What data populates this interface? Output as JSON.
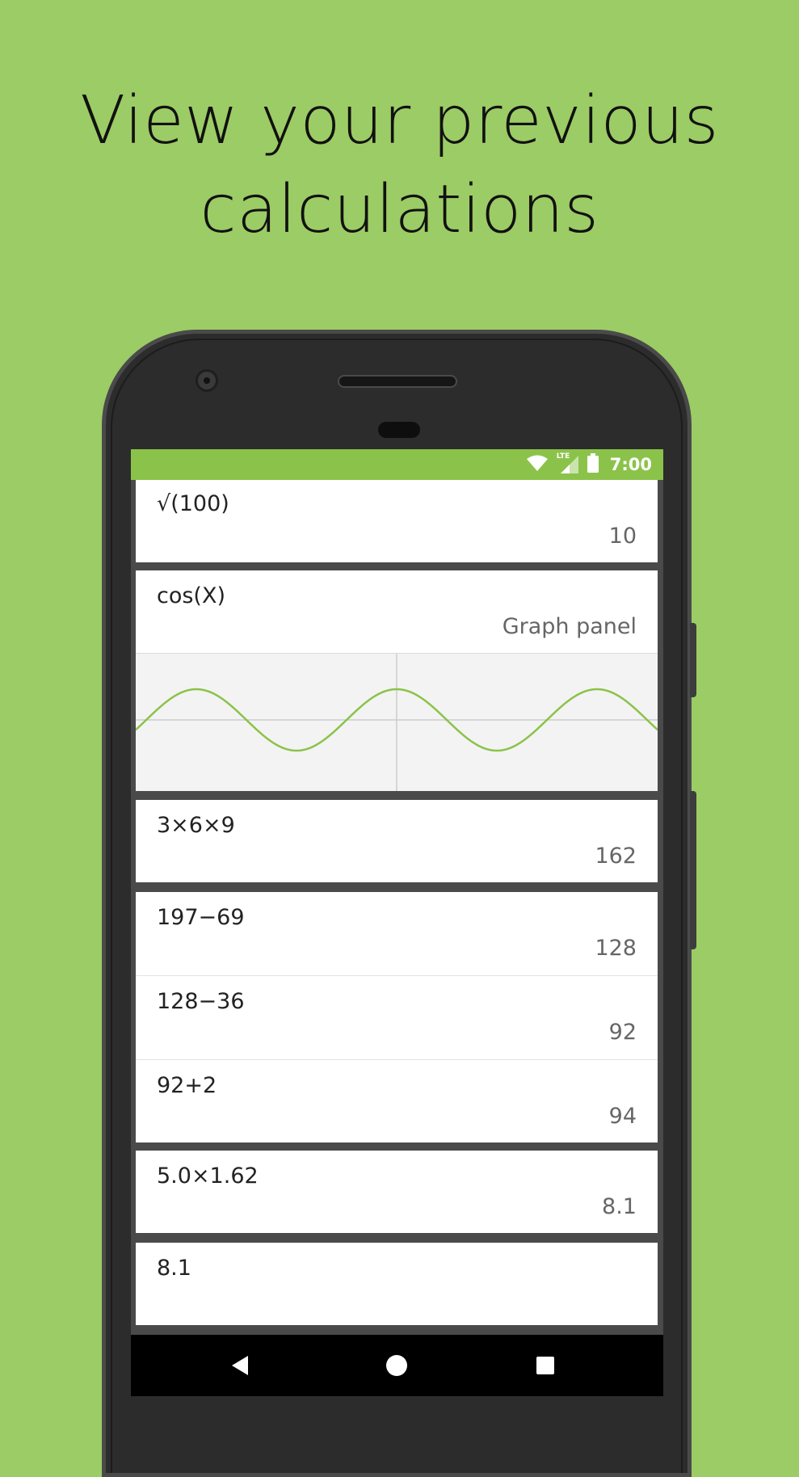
{
  "headline": {
    "line1": "View your previous",
    "line2": "calculations"
  },
  "status_bar": {
    "time": "7:00",
    "icons": [
      "wifi-icon",
      "lte-signal-icon",
      "battery-icon"
    ],
    "lte_label": "LTE"
  },
  "history": {
    "card1": {
      "expression": "√(100)",
      "result": "10"
    },
    "card2": {
      "expression": "cos(X)",
      "result": "Graph panel"
    },
    "card3": {
      "expression": "3×6×9",
      "result": "162"
    },
    "card4": {
      "rows": [
        {
          "expression": "197−69",
          "result": "128"
        },
        {
          "expression": "128−36",
          "result": "92"
        },
        {
          "expression": "92+2",
          "result": "94"
        }
      ]
    },
    "card5": {
      "expression": "5.0×1.62",
      "result": "8.1"
    },
    "card6": {
      "expression": "8.1",
      "result": ""
    }
  },
  "nav_bar": {
    "icons": [
      "back-icon",
      "home-icon",
      "recents-icon"
    ]
  },
  "colors": {
    "background": "#9ccc65",
    "status_bar": "#8bc34a",
    "graph_curve": "#8bc34a"
  }
}
